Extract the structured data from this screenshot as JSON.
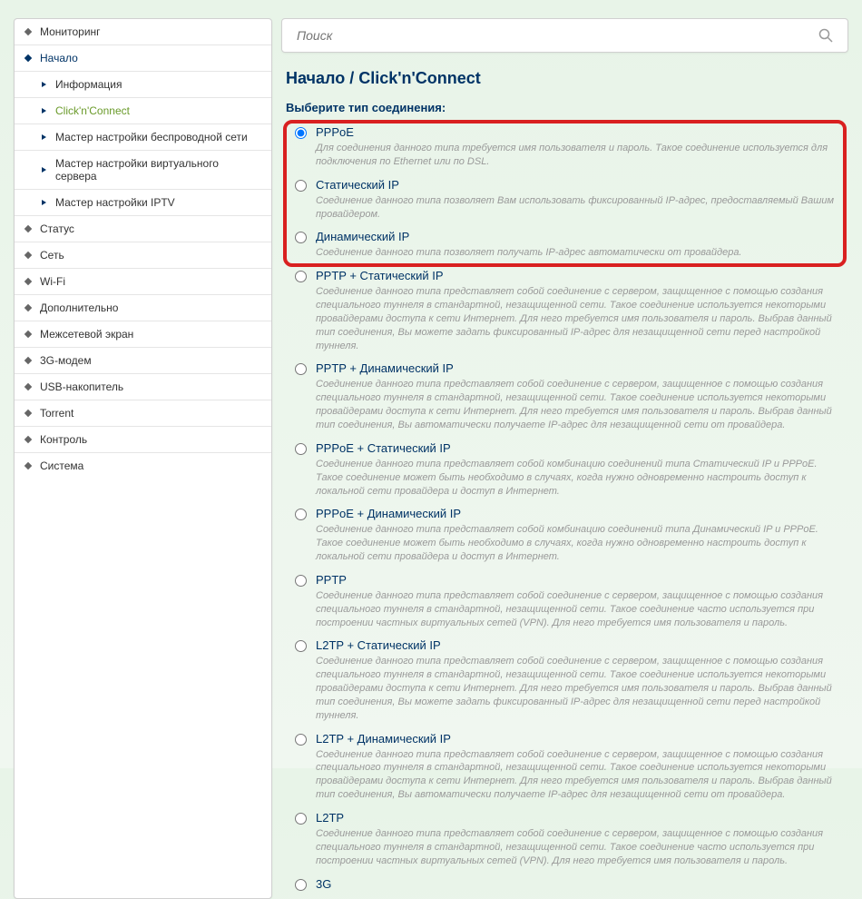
{
  "search": {
    "placeholder": "Поиск"
  },
  "breadcrumb": "Начало /  Click'n'Connect",
  "section_title": "Выберите тип соединения:",
  "sidebar": [
    {
      "label": "Мониторинг",
      "type": "top"
    },
    {
      "label": "Начало",
      "type": "top-active"
    },
    {
      "label": "Информация",
      "type": "sub"
    },
    {
      "label": "Click'n'Connect",
      "type": "sub-active"
    },
    {
      "label": "Мастер настройки беспроводной сети",
      "type": "sub"
    },
    {
      "label": "Мастер настройки виртуального сервера",
      "type": "sub"
    },
    {
      "label": "Мастер настройки IPTV",
      "type": "sub"
    },
    {
      "label": "Статус",
      "type": "top"
    },
    {
      "label": "Сеть",
      "type": "top"
    },
    {
      "label": "Wi-Fi",
      "type": "top"
    },
    {
      "label": "Дополнительно",
      "type": "top"
    },
    {
      "label": "Межсетевой экран",
      "type": "top"
    },
    {
      "label": "3G-модем",
      "type": "top"
    },
    {
      "label": "USB-накопитель",
      "type": "top"
    },
    {
      "label": "Torrent",
      "type": "top"
    },
    {
      "label": "Контроль",
      "type": "top"
    },
    {
      "label": "Система",
      "type": "top"
    }
  ],
  "options": [
    {
      "label": "PPPoE",
      "desc": "Для соединения данного типа требуется имя пользователя и пароль. Такое соединение используется для подключения по Ethernet или по DSL.",
      "checked": true
    },
    {
      "label": "Статический IP",
      "desc": "Соединение данного типа позволяет Вам использовать фиксированный IP-адрес, предоставляемый Вашим провайдером."
    },
    {
      "label": "Динамический IP",
      "desc": "Соединение данного типа позволяет получать IP-адрес автоматически от провайдера."
    },
    {
      "label": "PPTP + Статический IP",
      "desc": "Соединение данного типа представляет собой соединение с сервером, защищенное с помощью создания специального туннеля в стандартной, незащищенной сети. Такое соединение используется некоторыми провайдерами доступа к сети Интернет. Для него требуется имя пользователя и пароль. Выбрав данный тип соединения, Вы можете задать фиксированный IP-адрес для незащищенной сети перед настройкой туннеля."
    },
    {
      "label": "PPTP + Динамический IP",
      "desc": "Соединение данного типа представляет собой соединение с сервером, защищенное с помощью создания специального туннеля в стандартной, незащищенной сети. Такое соединение используется некоторыми провайдерами доступа к сети Интернет. Для него требуется имя пользователя и пароль. Выбрав данный тип соединения, Вы автоматически получаете IP-адрес для незащищенной сети от провайдера."
    },
    {
      "label": "PPPoE + Статический IP",
      "desc": "Соединение данного типа представляет собой комбинацию соединений типа Статический IP и PPPoE. Такое соединение может быть необходимо в случаях, когда нужно одновременно настроить доступ к локальной сети провайдера и доступ в Интернет."
    },
    {
      "label": "PPPoE + Динамический IP",
      "desc": "Соединение данного типа представляет собой комбинацию соединений типа Динамический IP и PPPoE. Такое соединение может быть необходимо в случаях, когда нужно одновременно настроить доступ к локальной сети провайдера и доступ в Интернет."
    },
    {
      "label": "PPTP",
      "desc": "Соединение данного типа представляет собой соединение с сервером, защищенное с помощью создания специального туннеля в стандартной, незащищенной сети. Такое соединение часто используется при построении частных виртуальных сетей (VPN). Для него требуется имя пользователя и пароль."
    },
    {
      "label": "L2TP + Статический IP",
      "desc": "Соединение данного типа представляет собой соединение с сервером, защищенное с помощью создания специального туннеля в стандартной, незащищенной сети. Такое соединение используется некоторыми провайдерами доступа к сети Интернет. Для него требуется имя пользователя и пароль. Выбрав данный тип соединения, Вы можете задать фиксированный IP-адрес для незащищенной сети перед настройкой туннеля."
    },
    {
      "label": "L2TP + Динамический IP",
      "desc": "Соединение данного типа представляет собой соединение с сервером, защищенное с помощью создания специального туннеля в стандартной, незащищенной сети. Такое соединение используется некоторыми провайдерами доступа к сети Интернет. Для него требуется имя пользователя и пароль. Выбрав данный тип соединения, Вы автоматически получаете IP-адрес для незащищенной сети от провайдера."
    },
    {
      "label": "L2TP",
      "desc": "Соединение данного типа представляет собой соединение с сервером, защищенное с помощью создания специального туннеля в стандартной, незащищенной сети. Такое соединение часто используется при построении частных виртуальных сетей (VPN). Для него требуется имя пользователя и пароль."
    },
    {
      "label": "3G",
      "desc": ""
    }
  ]
}
